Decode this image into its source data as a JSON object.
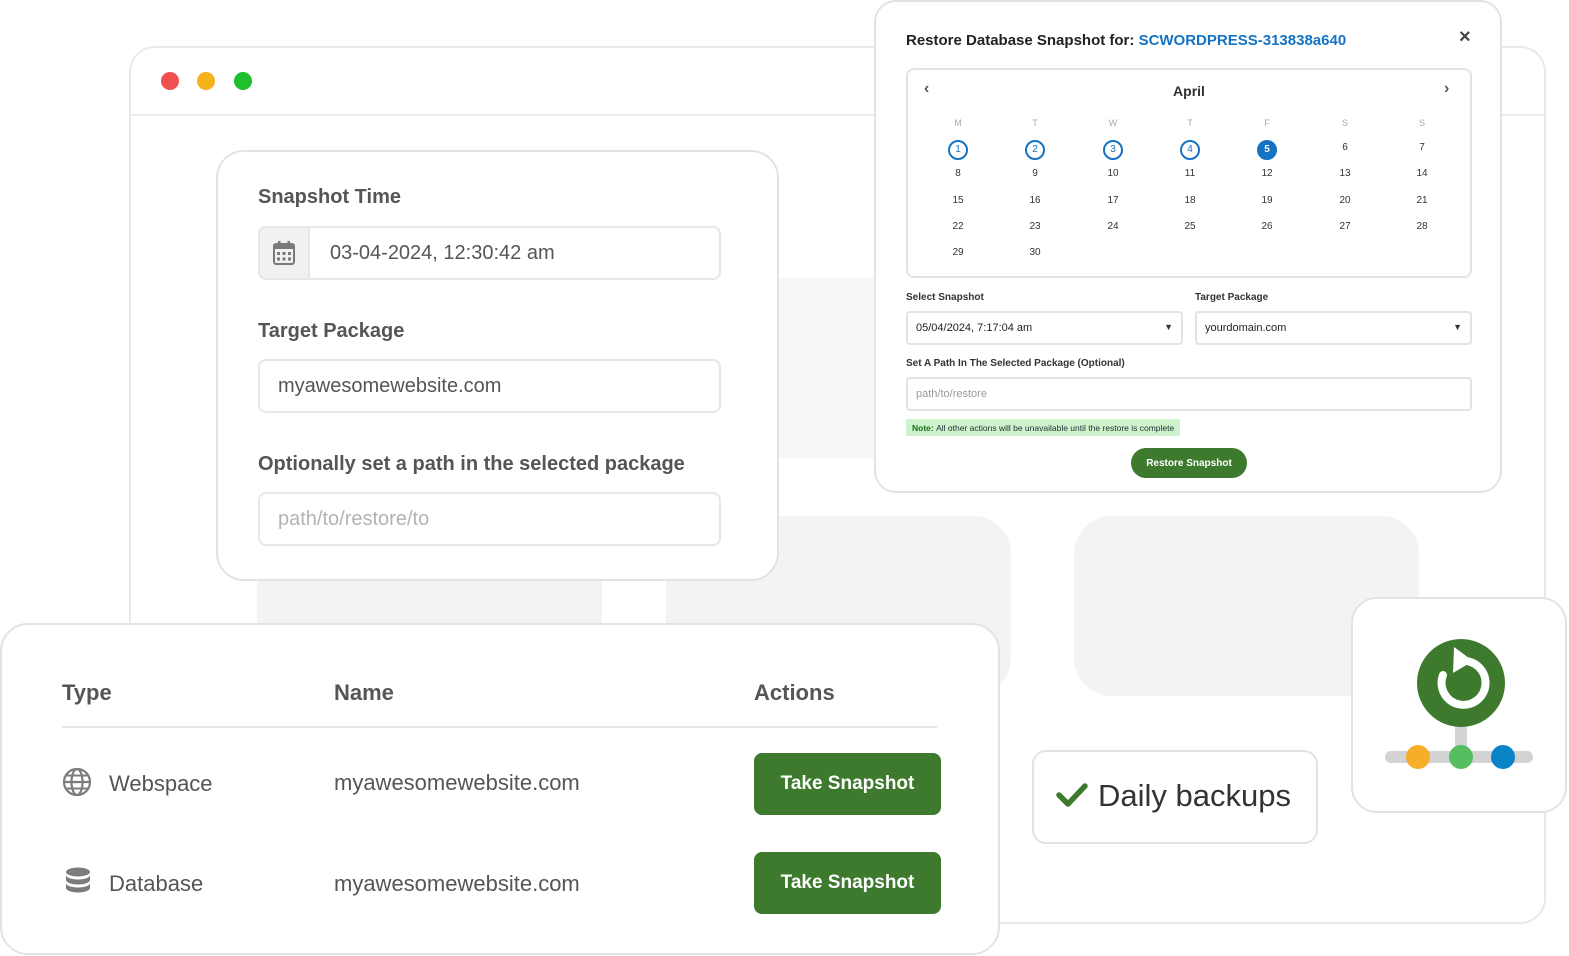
{
  "form": {
    "snapshot_time_label": "Snapshot Time",
    "snapshot_time_value": "03-04-2024, 12:30:42 am",
    "target_package_label": "Target Package",
    "target_package_value": "myawesomewebsite.com",
    "path_label": "Optionally set a path in the selected package",
    "path_placeholder": "path/to/restore/to"
  },
  "table": {
    "headers": {
      "type": "Type",
      "name": "Name",
      "actions": "Actions"
    },
    "rows": [
      {
        "icon": "globe-icon",
        "type": "Webspace",
        "name": "myawesomewebsite.com",
        "action": "Take Snapshot"
      },
      {
        "icon": "database-icon",
        "type": "Database",
        "name": "myawesomewebsite.com",
        "action": "Take Snapshot"
      }
    ]
  },
  "modal": {
    "title_prefix": "Restore Database Snapshot for:",
    "title_ref": "SCWORDPRESS-313838a640",
    "close_symbol": "×",
    "calendar": {
      "month": "April",
      "prev_symbol": "‹",
      "next_symbol": "›",
      "weekdays": [
        "M",
        "T",
        "W",
        "T",
        "F",
        "S",
        "S"
      ],
      "days": [
        1,
        2,
        3,
        4,
        5,
        6,
        7,
        8,
        9,
        10,
        11,
        12,
        13,
        14,
        15,
        16,
        17,
        18,
        19,
        20,
        21,
        22,
        23,
        24,
        25,
        26,
        27,
        28,
        29,
        30
      ],
      "snapshot_days": [
        1,
        2,
        3,
        4
      ],
      "selected_day": 5
    },
    "select_snapshot_label": "Select Snapshot",
    "select_snapshot_value": "05/04/2024, 7:17:04 am",
    "target_package_label": "Target Package",
    "target_package_value": "yourdomain.com",
    "path_label": "Set A Path In The Selected Package (Optional)",
    "path_placeholder": "path/to/restore",
    "note_prefix": "Note:",
    "note_text": "All other actions will be unavailable until the restore is complete",
    "restore_button": "Restore Snapshot"
  },
  "badge": {
    "daily_backups": "Daily backups"
  },
  "colors": {
    "accent_green": "#3e7a2d",
    "link_blue": "#1473c3",
    "dot_red": "#f04f4f",
    "dot_yellow": "#f6b21b",
    "dot_green": "#1fbf2d",
    "node_orange": "#f6ad2a",
    "node_green": "#55be5f",
    "node_blue": "#0a84c6"
  }
}
